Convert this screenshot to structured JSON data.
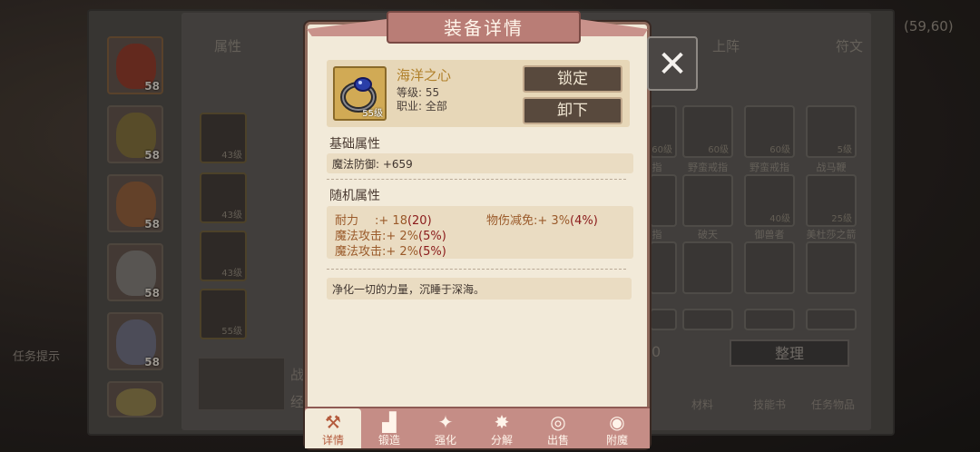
{
  "background": {
    "tabs": [
      "属性",
      "上阵",
      "符文"
    ],
    "coords": "(59,60)",
    "hero_levels": [
      "58",
      "58",
      "58",
      "58",
      "58"
    ],
    "equip_levels": [
      "43级",
      "43级",
      "43级",
      "55级"
    ],
    "detail_labels": [
      "战",
      "经"
    ],
    "grid_row1": [
      {
        "label": "指",
        "level": "60级"
      },
      {
        "label": "野蛮戒指",
        "level": "60级"
      },
      {
        "label": "野蛮戒指",
        "level": "60级"
      },
      {
        "label": "战马鞭",
        "level": "5级"
      }
    ],
    "grid_row2": [
      {
        "label": "指",
        "level": ""
      },
      {
        "label": "破天",
        "level": ""
      },
      {
        "label": "御兽者",
        "level": "40级"
      },
      {
        "label": "美杜莎之箭",
        "level": "25级"
      }
    ],
    "count_fragment": "0",
    "sort_button": "整理",
    "categories": [
      "材料",
      "技能书",
      "任务物品"
    ],
    "left_hint": "任务提示"
  },
  "modal": {
    "title": "装备详情",
    "item": {
      "name": "海洋之心",
      "level_line": "等级:  55",
      "class_line": "职业:  全部",
      "icon_level": "55级",
      "icon_name": "ring-icon"
    },
    "buttons": {
      "lock": "锁定",
      "unequip": "卸下"
    },
    "base_section": {
      "title": "基础属性",
      "stat": "魔法防御: +659"
    },
    "random_section": {
      "title": "随机属性",
      "stats": [
        {
          "name": "耐力",
          "value": ":+ 18",
          "range": "(20)"
        },
        {
          "name": "物伤减免",
          "value": ":+ 3%",
          "range": "(4%)"
        },
        {
          "name": "魔法攻击",
          "value": ":+ 2%",
          "range": "(5%)"
        },
        {
          "name": "魔法攻击",
          "value": ":+ 2%",
          "range": "(5%)"
        }
      ]
    },
    "description": "净化一切的力量，沉睡于深海。",
    "tabs": [
      {
        "label": "详情",
        "icon": "hammer-pick-icon"
      },
      {
        "label": "锻造",
        "icon": "anvil-icon"
      },
      {
        "label": "强化",
        "icon": "sparkle-wand-icon"
      },
      {
        "label": "分解",
        "icon": "break-icon"
      },
      {
        "label": "出售",
        "icon": "coins-icon"
      },
      {
        "label": "附魔",
        "icon": "eye-magic-icon"
      }
    ],
    "close_symbol": "✕"
  },
  "colors": {
    "modal_bg": "#f2ead9",
    "ribbon": "#b97d76",
    "stat_text": "#9a5a2a",
    "range_text": "#8a1a1a",
    "item_name": "#b0802a"
  }
}
